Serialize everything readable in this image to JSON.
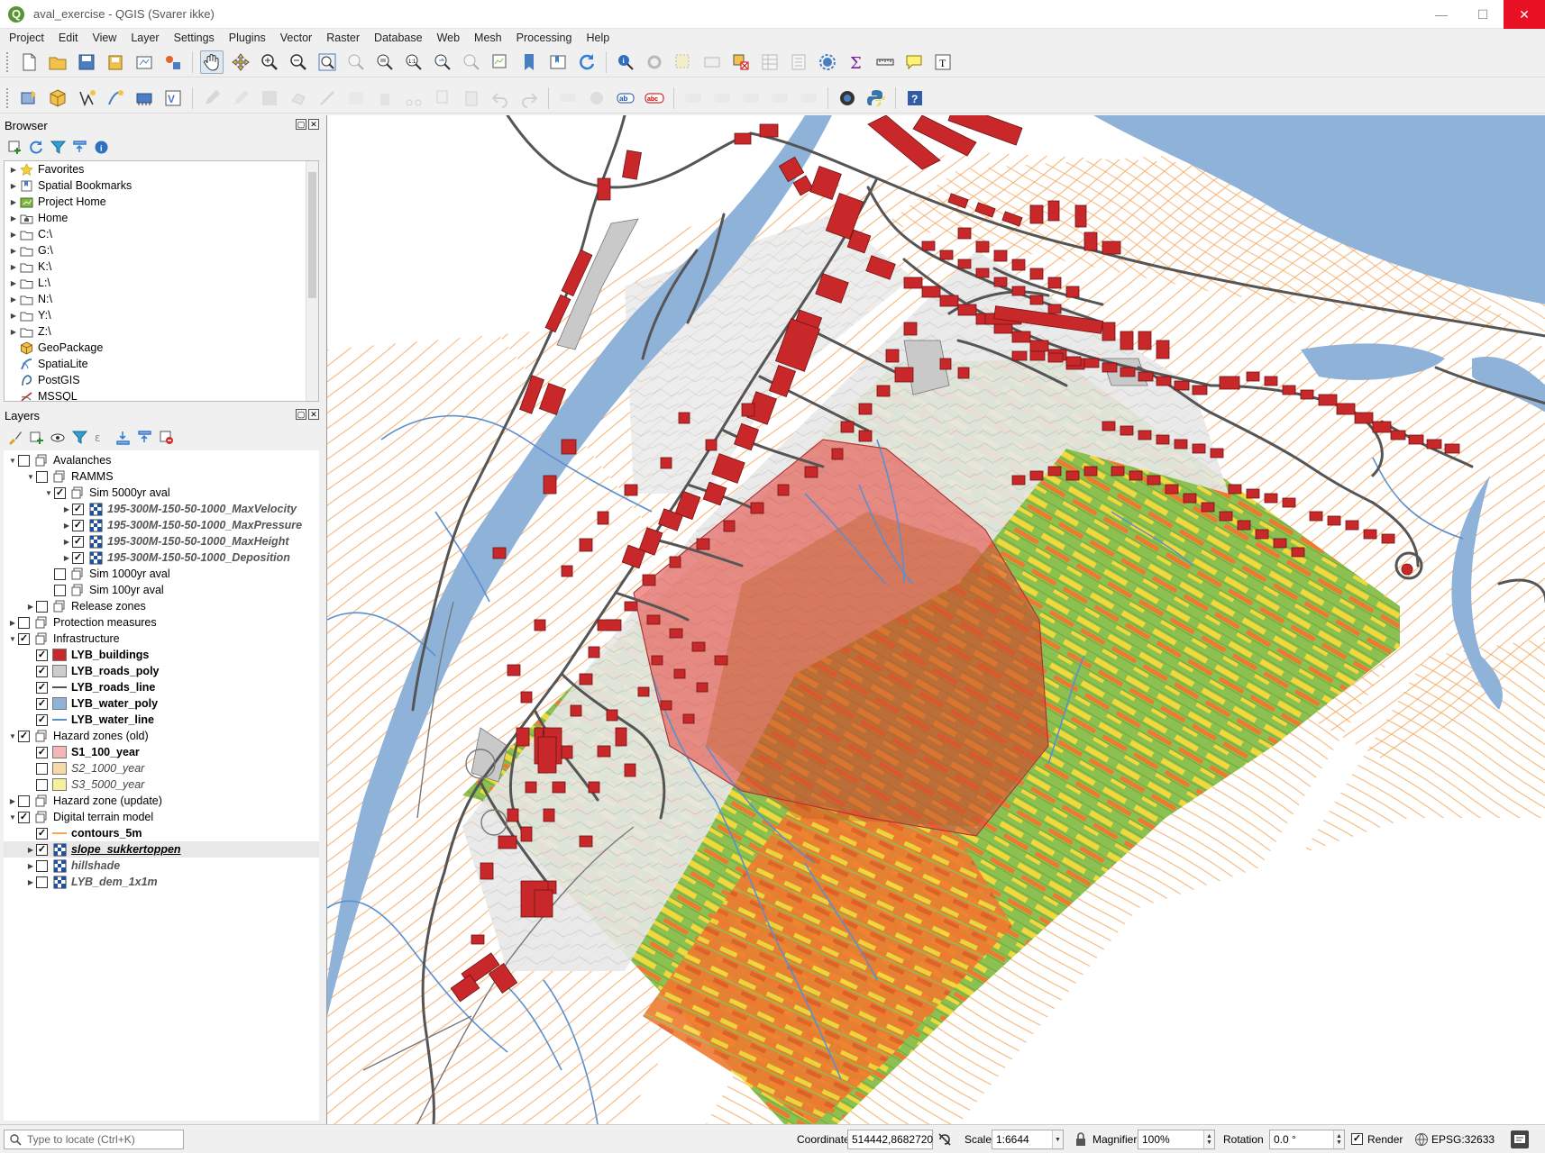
{
  "window": {
    "title": "aval_exercise - QGIS (Svarer ikke)",
    "logo": "Q"
  },
  "menu": [
    "Project",
    "Edit",
    "View",
    "Layer",
    "Settings",
    "Plugins",
    "Vector",
    "Raster",
    "Database",
    "Web",
    "Mesh",
    "Processing",
    "Help"
  ],
  "browser": {
    "title": "Browser",
    "items": [
      {
        "label": "Favorites",
        "icon": "star-icon"
      },
      {
        "label": "Spatial Bookmarks",
        "icon": "bookmark-icon"
      },
      {
        "label": "Project Home",
        "icon": "project-home-icon"
      },
      {
        "label": "Home",
        "icon": "home-folder-icon"
      },
      {
        "label": "C:\\",
        "icon": "drive-icon"
      },
      {
        "label": "G:\\",
        "icon": "drive-icon"
      },
      {
        "label": "K:\\",
        "icon": "drive-icon"
      },
      {
        "label": "L:\\",
        "icon": "drive-icon"
      },
      {
        "label": "N:\\",
        "icon": "drive-icon"
      },
      {
        "label": "Y:\\",
        "icon": "drive-icon"
      },
      {
        "label": "Z:\\",
        "icon": "drive-icon"
      },
      {
        "label": "GeoPackage",
        "icon": "geopackage-icon"
      },
      {
        "label": "SpatiaLite",
        "icon": "spatialite-icon"
      },
      {
        "label": "PostGIS",
        "icon": "postgis-icon"
      },
      {
        "label": "MSSQL",
        "icon": "mssql-icon"
      }
    ]
  },
  "layers": {
    "title": "Layers",
    "items": [
      {
        "label": "Avalanches",
        "style": "normal",
        "checked": false
      },
      {
        "label": "RAMMS",
        "style": "normal",
        "checked": false
      },
      {
        "label": "Sim 5000yr aval",
        "style": "normal",
        "checked": true
      },
      {
        "label": "195-300M-150-50-1000_MaxVelocity",
        "style": "italicbold",
        "checked": true
      },
      {
        "label": "195-300M-150-50-1000_MaxPressure",
        "style": "italicbold",
        "checked": true
      },
      {
        "label": "195-300M-150-50-1000_MaxHeight",
        "style": "italicbold",
        "checked": true
      },
      {
        "label": "195-300M-150-50-1000_Deposition",
        "style": "italicbold",
        "checked": true
      },
      {
        "label": "Sim 1000yr aval",
        "style": "normal",
        "checked": false
      },
      {
        "label": "Sim 100yr aval",
        "style": "normal",
        "checked": false
      },
      {
        "label": "Release zones",
        "style": "normal",
        "checked": false
      },
      {
        "label": "Protection measures",
        "style": "normal",
        "checked": false
      },
      {
        "label": "Infrastructure",
        "style": "normal",
        "checked": true
      },
      {
        "label": "LYB_buildings",
        "style": "bold",
        "checked": true
      },
      {
        "label": "LYB_roads_poly",
        "style": "bold",
        "checked": true
      },
      {
        "label": "LYB_roads_line",
        "style": "bold",
        "checked": true
      },
      {
        "label": "LYB_water_poly",
        "style": "bold",
        "checked": true
      },
      {
        "label": "LYB_water_line",
        "style": "bold",
        "checked": true
      },
      {
        "label": "Hazard zones (old)",
        "style": "normal",
        "checked": true
      },
      {
        "label": "S1_100_year",
        "style": "bold",
        "checked": true
      },
      {
        "label": "S2_1000_year",
        "style": "italic",
        "checked": false
      },
      {
        "label": "S3_5000_year",
        "style": "italic",
        "checked": false
      },
      {
        "label": "Hazard zone (update)",
        "style": "normal",
        "checked": false
      },
      {
        "label": "Digital terrain model",
        "style": "normal",
        "checked": true
      },
      {
        "label": "contours_5m",
        "style": "bold",
        "checked": true
      },
      {
        "label": "slope_sukkertoppen",
        "style": "under",
        "checked": true
      },
      {
        "label": "hillshade",
        "style": "italicbold",
        "checked": false
      },
      {
        "label": "LYB_dem_1x1m",
        "style": "italicbold",
        "checked": false
      }
    ]
  },
  "status": {
    "locate_placeholder": "Type to locate (Ctrl+K)",
    "coordinate_label": "Coordinate",
    "coordinate_value": "514442,8682720",
    "scale_label": "Scale",
    "scale_value": "1:6644",
    "magnifier_label": "Magnifier",
    "magnifier_value": "100%",
    "rotation_label": "Rotation",
    "rotation_value": "0.0 °",
    "render_label": "Render",
    "crs_label": "EPSG:32633"
  },
  "colors": {
    "buildings": "#c8282a",
    "roads": "#555555",
    "road_poly": "#cccccc",
    "water": "#8fb2d9",
    "water_line": "#5b8fce",
    "contour": "#f5a65b",
    "hazard_s1": "#f4b6b6",
    "hazard_s2": "#f5d9a8",
    "hazard_s3": "#f5f09a",
    "slope_low": "#7fb843",
    "slope_mid": "#f2d83a",
    "slope_high": "#ef7a2f",
    "qgis_green": "#589632"
  }
}
